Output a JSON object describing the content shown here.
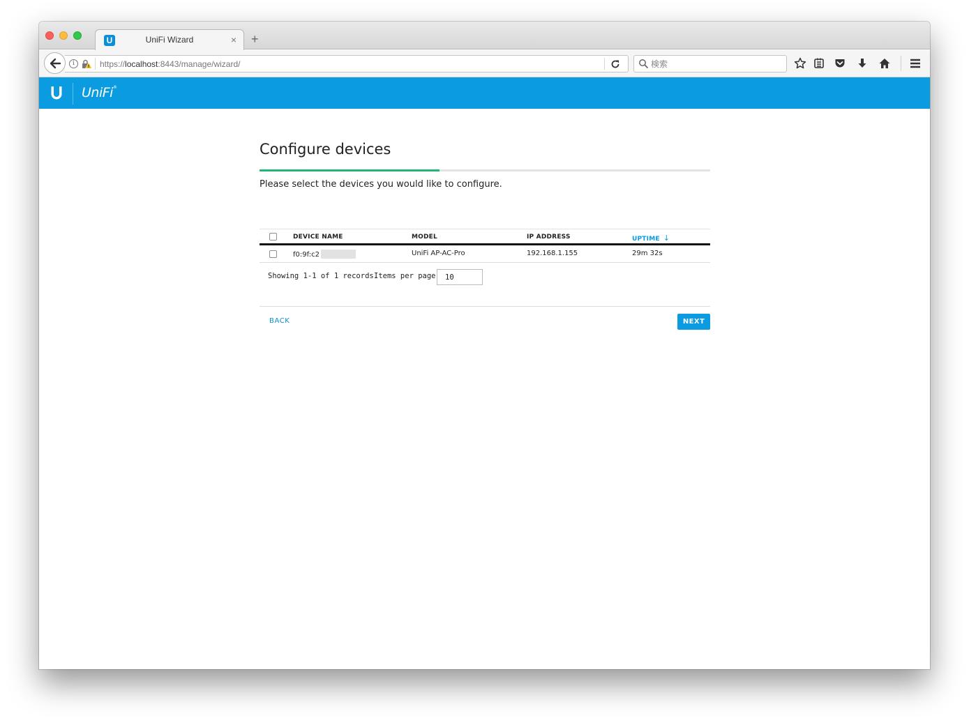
{
  "browser": {
    "tab_title": "UniFi Wizard",
    "tab_favicon_letter": "U",
    "new_tab_symbol": "+",
    "tab_close_symbol": "×",
    "url_prefix": "https://",
    "url_host": "localhost",
    "url_rest": ":8443/manage/wizard/",
    "search_placeholder": "検索",
    "info_symbol": "i"
  },
  "app": {
    "brand": "UniFi",
    "brand_color": "#0a9be0",
    "accent_green": "#22b573"
  },
  "wizard": {
    "title": "Configure devices",
    "progress": 0.4,
    "subtitle": "Please select the devices you would like to configure.",
    "table": {
      "columns": [
        "DEVICE NAME",
        "MODEL",
        "IP ADDRESS",
        "UPTIME"
      ],
      "sorted_column": "UPTIME",
      "sort_arrow": "↓",
      "rows": [
        {
          "device_name": "f0:9f:c2",
          "model": "UniFi AP-AC-Pro",
          "ip_address": "192.168.1.155",
          "uptime": "29m 32s"
        }
      ]
    },
    "pager": {
      "showing_text": "Showing 1-1 of 1 records.",
      "items_per_page_label": "Items per page:",
      "items_per_page_value": "10"
    },
    "back_label": "BACK",
    "next_label": "NEXT"
  }
}
